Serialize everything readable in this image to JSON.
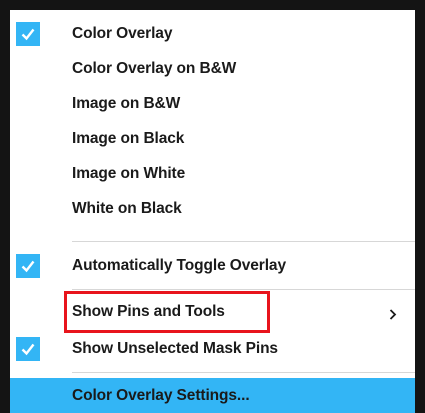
{
  "menu": {
    "items": [
      {
        "label": "Color Overlay",
        "checked": true
      },
      {
        "label": "Color Overlay on B&W",
        "checked": false
      },
      {
        "label": "Image on B&W",
        "checked": false
      },
      {
        "label": "Image on Black",
        "checked": false
      },
      {
        "label": "Image on White",
        "checked": false
      },
      {
        "label": "White on Black",
        "checked": false
      },
      {
        "label": "Automatically Toggle Overlay",
        "checked": true
      },
      {
        "label": "Show Pins and Tools",
        "checked": false,
        "submenu": true,
        "annotated": true
      },
      {
        "label": "Show Unselected Mask Pins",
        "checked": true
      },
      {
        "label": "Color Overlay Settings...",
        "checked": false,
        "selected": true
      }
    ]
  },
  "colors": {
    "check_background": "#33b5f5",
    "selected_background": "#33b5f5",
    "annotation_border": "#e8141c",
    "window_border": "#141414",
    "separator": "#d7d7d7"
  },
  "icons": {
    "check": "check-icon",
    "submenu": "chevron-right-icon"
  }
}
